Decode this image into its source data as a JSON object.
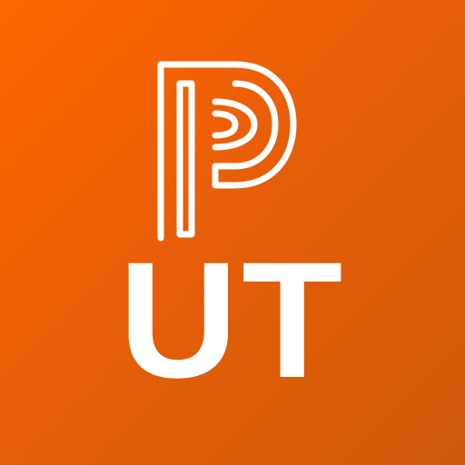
{
  "app_icon": {
    "logo_icon": "powerschool-p-logo-icon",
    "initials": "UT",
    "colors": {
      "background_start": "#ff6600",
      "background_end": "#cc5a0a",
      "foreground": "#ffffff"
    }
  }
}
